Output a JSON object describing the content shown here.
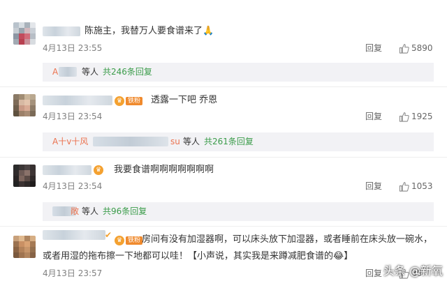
{
  "comments": [
    {
      "text": "陈施主，我替万人要食谱来了🙏",
      "time": "4月13日 23:55",
      "reply": "回复",
      "likes": "5890",
      "sub": {
        "names": "A",
        "deng": "等人",
        "count": "共246条回复"
      }
    },
    {
      "badge": "铁粉",
      "text": "透露一下吧  乔恩",
      "time": "4月13日 23:54",
      "reply": "回复",
      "likes": "1925",
      "sub": {
        "names_start": "A十v十风",
        "names_end": "su",
        "deng": "等人",
        "count": "共261条回复"
      }
    },
    {
      "text": "我要食谱啊啊啊啊啊啊啊",
      "time": "4月13日 23:54",
      "reply": "回复",
      "likes": "1053",
      "sub": {
        "names_end": "敞",
        "deng": "等人",
        "count": "共96条回复"
      }
    },
    {
      "badge": "铁粉",
      "text_line1": "房间有没有加湿器啊，可以床头放下加湿器，或者睡前在床头放一碗水，",
      "text_line2": "或者用湿的拖布擦一下地都可以哇！【小声说，其实我是来蹲减肥食谱的😂】",
      "time": "4月13日 23:57",
      "reply": "回复",
      "likes": "35"
    }
  ],
  "watermark": "头条 @新氧",
  "colors": {
    "link_green": "#3b9c4a",
    "name_orange": "#eb7350",
    "box_bg": "#f2f2f5",
    "meta_gray": "#808080"
  },
  "icons": {
    "like": "thumbs-up-icon",
    "fan_badge": "crown-icon"
  }
}
